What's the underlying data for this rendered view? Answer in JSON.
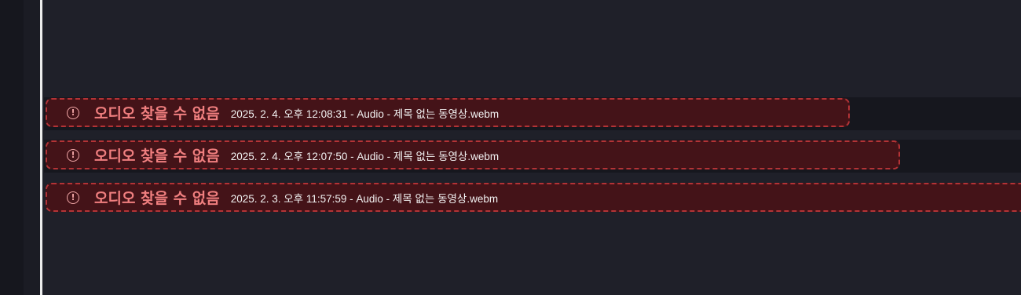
{
  "alerts": [
    {
      "title": "오디오 찾을 수 없음",
      "meta": "2025. 2. 4. 오후 12:08:31 - Audio - 제목 없는 동영상.webm",
      "icon": "alert-circle-icon"
    },
    {
      "title": "오디오 찾을 수 없음",
      "meta": "2025. 2. 4. 오후 12:07:50 - Audio - 제목 없는 동영상.webm",
      "icon": "alert-circle-icon"
    },
    {
      "title": "오디오 찾을 수 없음",
      "meta": "2025. 2. 3. 오후 11:57:59 - Audio - 제목 없는 동영상.webm",
      "icon": "alert-circle-icon"
    }
  ],
  "colors": {
    "card_background": "#441318",
    "card_border": "#b43336",
    "title_text": "#f07f7f",
    "meta_text": "#f2f2f2",
    "page_background": "#1f2029"
  }
}
